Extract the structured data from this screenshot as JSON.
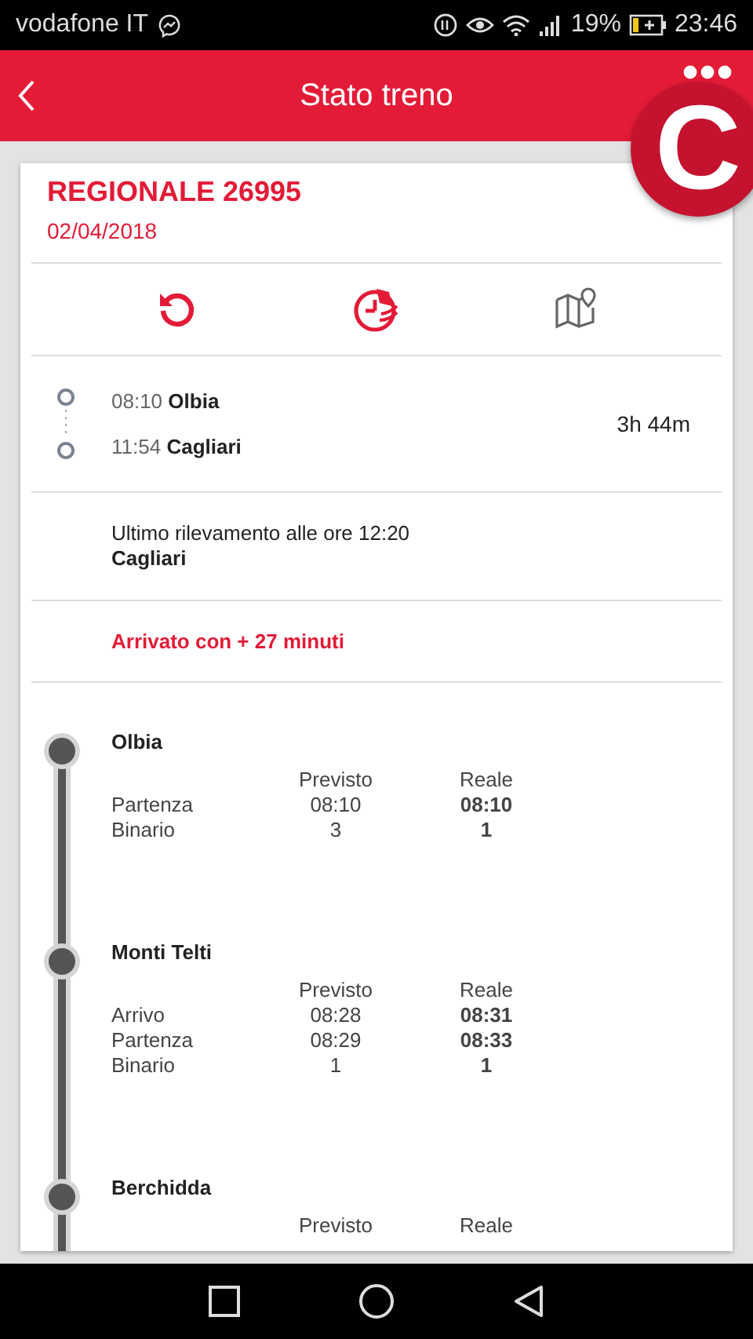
{
  "status_bar": {
    "carrier": "vodafone IT",
    "battery": "19%",
    "time": "23:46"
  },
  "header": {
    "title": "Stato treno"
  },
  "overlay_badge": {
    "label": "C"
  },
  "train": {
    "name": "REGIONALE 26995",
    "date": "02/04/2018"
  },
  "actions": [
    {
      "kind": "refresh"
    },
    {
      "kind": "alarm"
    },
    {
      "kind": "map"
    }
  ],
  "route": {
    "departure": {
      "time": "08:10",
      "station": "Olbia"
    },
    "arrival": {
      "time": "11:54",
      "station": "Cagliari"
    },
    "duration": "3h 44m"
  },
  "last_detection": {
    "text": "Ultimo rilevamento alle ore 12:20",
    "station": "Cagliari"
  },
  "delay_status": "Arrivato con + 27 minuti",
  "stops": [
    {
      "name": "Olbia",
      "column_headers": [
        "Previsto",
        "Reale"
      ],
      "rows": [
        {
          "label": "Partenza",
          "planned": "08:10",
          "actual": "08:10"
        },
        {
          "label": "Binario",
          "planned": "3",
          "actual": "1"
        }
      ]
    },
    {
      "name": "Monti Telti",
      "column_headers": [
        "Previsto",
        "Reale"
      ],
      "rows": [
        {
          "label": "Arrivo",
          "planned": "08:28",
          "actual": "08:31"
        },
        {
          "label": "Partenza",
          "planned": "08:29",
          "actual": "08:33"
        },
        {
          "label": "Binario",
          "planned": "1",
          "actual": "1"
        }
      ]
    },
    {
      "name": "Berchidda",
      "column_headers": [
        "Previsto",
        "Reale"
      ]
    }
  ]
}
